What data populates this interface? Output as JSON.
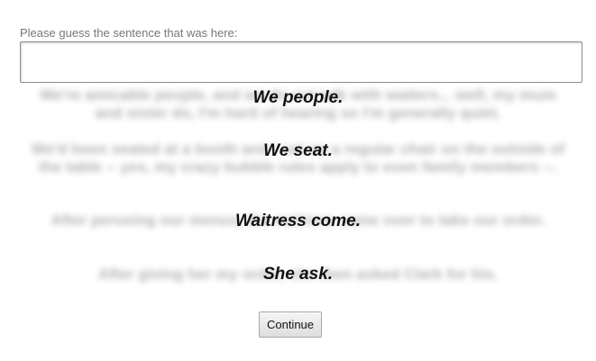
{
  "prompt": {
    "label": "Please guess the sentence that was here:"
  },
  "guess_input": {
    "value": "",
    "placeholder": ""
  },
  "paragraphs": [
    {
      "blurred": "We're amicable people, and we do not talk with waiters... well, my mum and sister do, I'm hard of hearing so I'm generally quiet.",
      "visible": "We people."
    },
    {
      "blurred": "We'd been seated at a booth and I sat on a regular chair on the outside of the table -- yes, my crazy bubble rules apply to even family members --.",
      "visible": "We seat."
    },
    {
      "blurred": "After perusing our menus, the waitress came over to take our order.",
      "visible": "Waitress come."
    },
    {
      "blurred": "After giving her my order, she then asked Clark for his.",
      "visible": "She ask."
    }
  ],
  "continue_button": {
    "label": "Continue"
  }
}
